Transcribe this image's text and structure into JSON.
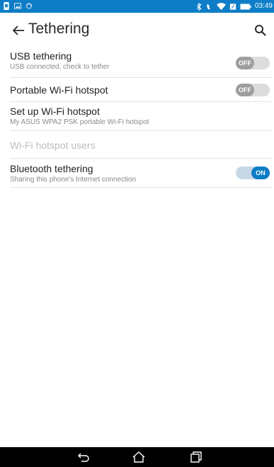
{
  "status_bar": {
    "time": "03:49",
    "icons_left": [
      "sim-icon",
      "image-icon",
      "sync-icon"
    ],
    "icons_right": [
      "bluetooth-icon",
      "phone-icon",
      "wifi-icon",
      "usb-icon",
      "battery-icon"
    ],
    "accent": "#0e7dc7"
  },
  "app_bar": {
    "title": "Tethering"
  },
  "settings": [
    {
      "title": "USB tethering",
      "subtitle": "USB connected, check to tether",
      "toggle": "OFF"
    },
    {
      "title": "Portable Wi-Fi hotspot",
      "subtitle": "",
      "toggle": "OFF"
    },
    {
      "title": "Set up Wi-Fi hotspot",
      "subtitle": "My ASUS WPA2 PSK portable Wi-Fi hotspot",
      "toggle": null
    },
    {
      "title": "Wi-Fi hotspot users",
      "subtitle": "",
      "toggle": null,
      "disabled": true
    },
    {
      "title": "Bluetooth tethering",
      "subtitle": "Sharing this phone's Internet connection",
      "toggle": "ON"
    }
  ],
  "nav_bar": {
    "buttons": [
      "back-nav-icon",
      "home-nav-icon",
      "recents-nav-icon"
    ]
  }
}
